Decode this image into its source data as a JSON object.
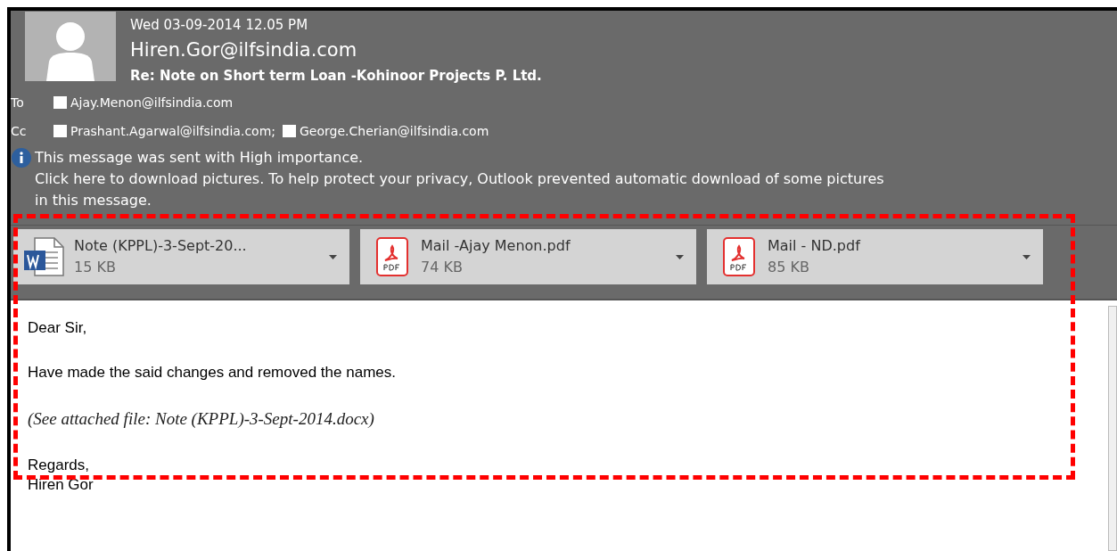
{
  "header": {
    "date": "Wed 03-09-2014 12.05 PM",
    "sender": "Hiren.Gor@ilfsindia.com",
    "subject": "Re: Note on Short term Loan -Kohinoor Projects P. Ltd."
  },
  "recipients": [
    {
      "label": "To",
      "addresses": [
        "Ajay.Menon@ilfsindia.com"
      ]
    },
    {
      "label": "Cc",
      "addresses": [
        "Prashant.Agarwal@ilfsindia.com;",
        "George.Cherian@ilfsindia.com"
      ]
    }
  ],
  "info": {
    "importance": "This message was sent with High importance.",
    "pictures": "Click here to download pictures. To help protect your privacy, Outlook prevented automatic download of some pictures",
    "pictures_cont": "in this message."
  },
  "attachments": [
    {
      "kind": "word",
      "name": "Note (KPPL)-3-Sept-20...",
      "size": "15 KB"
    },
    {
      "kind": "pdf",
      "name": "Mail -Ajay Menon.pdf",
      "size": "74 KB"
    },
    {
      "kind": "pdf",
      "name": "Mail - ND.pdf",
      "size": "85 KB"
    }
  ],
  "body": [
    {
      "kind": "plain",
      "text": "Dear Sir,"
    },
    {
      "kind": "plain",
      "text": "Have made the said changes and removed the names."
    },
    {
      "kind": "italic",
      "text": "(See attached file: Note (KPPL)-3-Sept-2014.docx)"
    },
    {
      "kind": "signoff",
      "lines": [
        "Regards,",
        "Hiren Gor"
      ]
    }
  ],
  "annotation": {
    "kind": "dashed"
  }
}
